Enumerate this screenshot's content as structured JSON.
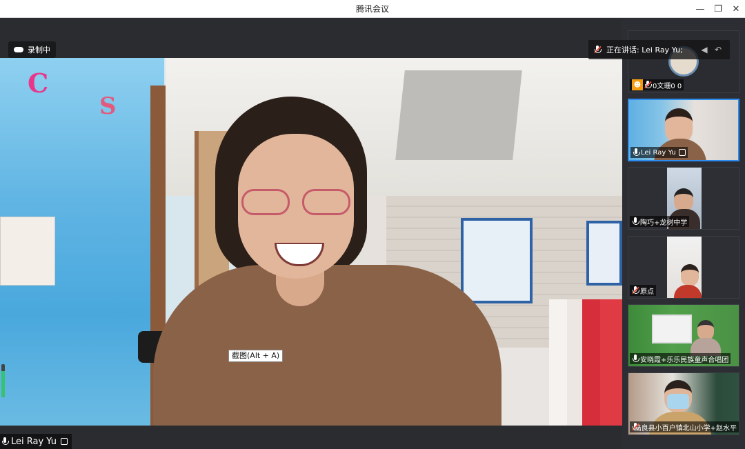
{
  "window": {
    "title": "腾讯会议",
    "minimize_icon": "minimize-icon",
    "restore_icon": "restore-icon",
    "close_icon": "close-icon"
  },
  "main": {
    "recording_label": "录制中",
    "speaking_label": "正在讲话: Lei Ray Yu;",
    "screenshot_tooltip": "截图(Alt + A)",
    "main_speaker_name": "Lei Ray Yu",
    "mic_level": 0.8
  },
  "sidebar": {
    "participants": [
      {
        "name": "0文珊0 0",
        "mic": "muted",
        "badge": "user-icon"
      },
      {
        "name": "Lei Ray Yu",
        "mic": "on",
        "active": true
      },
      {
        "name": "陶巧+龙树中学",
        "mic": "on"
      },
      {
        "name": "原点",
        "mic": "muted"
      },
      {
        "name": "安晓霞+乐乐民族童声合唱团",
        "mic": "on"
      },
      {
        "name": "陆良县小百户镇北山小学+赵水平",
        "mic": "muted"
      }
    ]
  },
  "colors": {
    "accent": "#2d8cf0",
    "sidebar_bg": "#2c2e33",
    "stage_bg": "#2a2c30"
  }
}
